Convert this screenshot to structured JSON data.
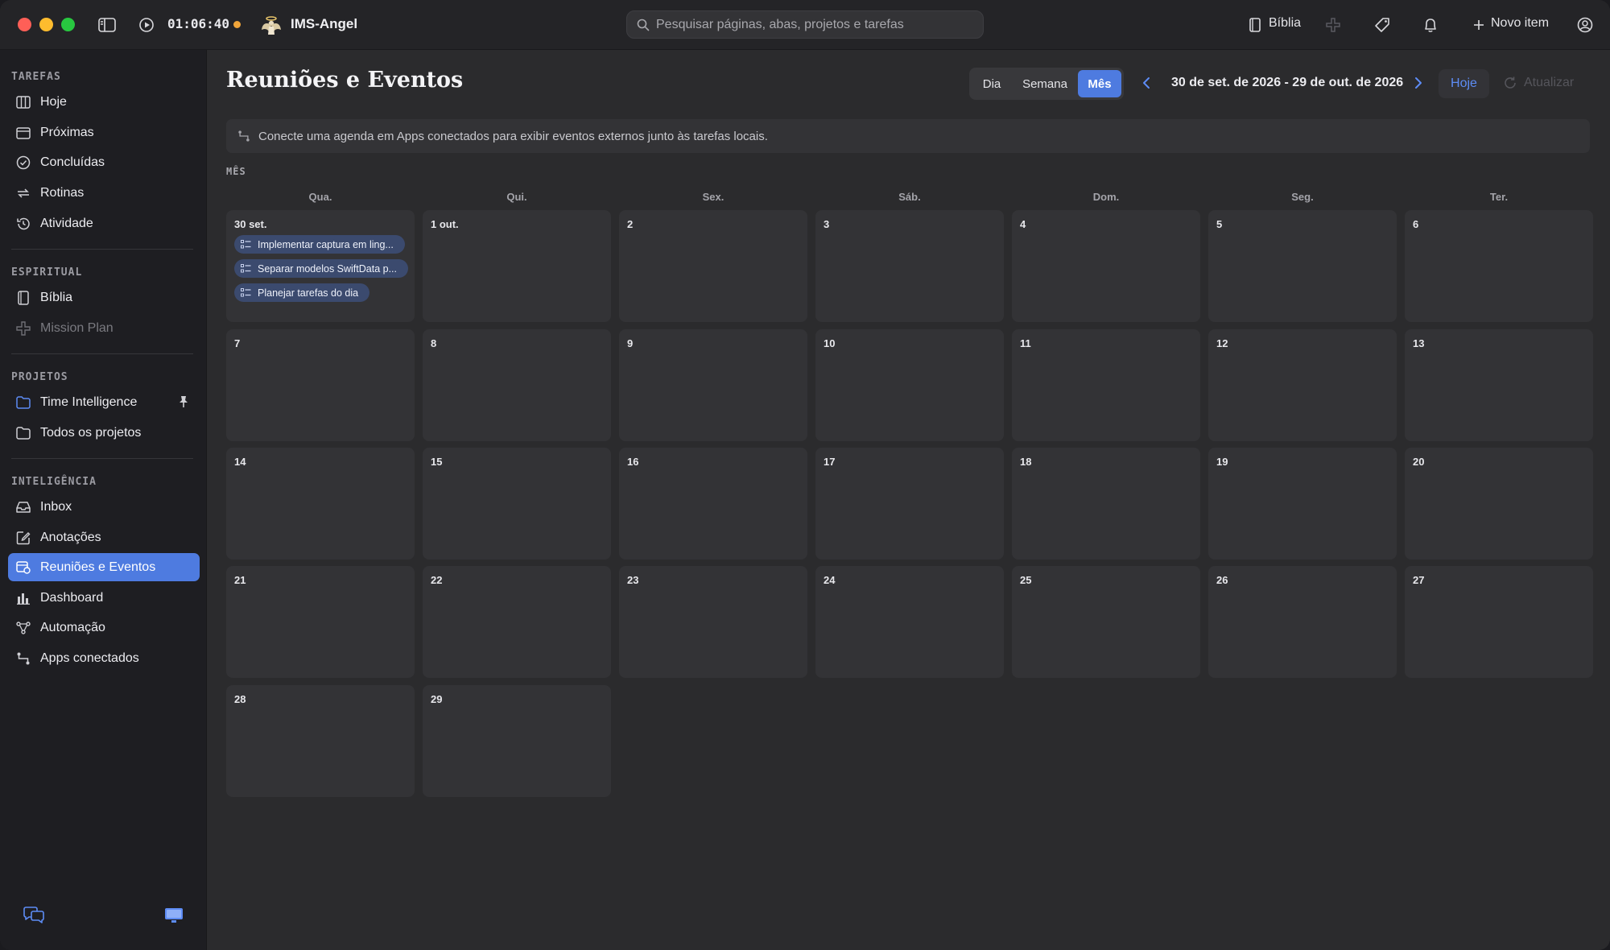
{
  "titlebar": {
    "timer": "01:06:40",
    "app_name": "IMS-Angel",
    "search_placeholder": "Pesquisar páginas, abas, projetos e tarefas",
    "bible_label": "Bíblia",
    "new_item_label": "Novo item"
  },
  "sidebar": {
    "sections": {
      "tarefas": "TAREFAS",
      "espiritual": "ESPIRITUAL",
      "projetos": "PROJETOS",
      "inteligencia": "INTELIGÊNCIA"
    },
    "items": {
      "hoje": "Hoje",
      "proximas": "Próximas",
      "concluidas": "Concluídas",
      "rotinas": "Rotinas",
      "atividade": "Atividade",
      "biblia": "Bíblia",
      "mission_plan": "Mission Plan",
      "time_intelligence": "Time Intelligence",
      "todos_projetos": "Todos os projetos",
      "inbox": "Inbox",
      "anotacoes": "Anotações",
      "reunioes": "Reuniões e Eventos",
      "dashboard": "Dashboard",
      "automacao": "Automação",
      "apps_conectados": "Apps conectados"
    }
  },
  "main": {
    "title": "Reuniões e Eventos",
    "view_tabs": [
      "Dia",
      "Semana",
      "Mês"
    ],
    "active_view": "Mês",
    "date_range": "30 de set. de 2026 - 29 de out. de 2026",
    "today_label": "Hoje",
    "refresh_label": "Atualizar",
    "banner": "Conecte uma agenda em Apps conectados para exibir eventos externos junto às tarefas locais.",
    "month_label": "MÊS",
    "weekdays": [
      "Qua.",
      "Qui.",
      "Sex.",
      "Sáb.",
      "Dom.",
      "Seg.",
      "Ter."
    ],
    "days": [
      "30 set.",
      "1 out.",
      "2",
      "3",
      "4",
      "5",
      "6",
      "7",
      "8",
      "9",
      "10",
      "11",
      "12",
      "13",
      "14",
      "15",
      "16",
      "17",
      "18",
      "19",
      "20",
      "21",
      "22",
      "23",
      "24",
      "25",
      "26",
      "27",
      "28",
      "29"
    ],
    "events": [
      "Implementar captura em ling...",
      "Separar modelos SwiftData p...",
      "Planejar tarefas do dia"
    ]
  }
}
